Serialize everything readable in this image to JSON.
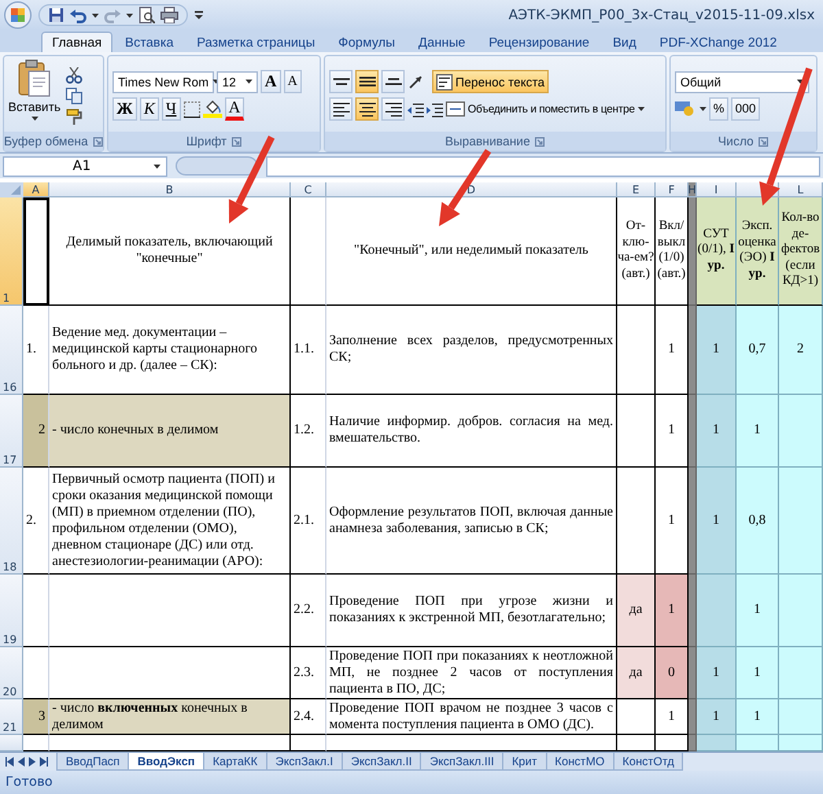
{
  "window": {
    "title": "АЭТК-ЭКМП_Р00_3х-Стац_v2015-11-09.xlsx"
  },
  "ribbon_tabs": [
    {
      "label": "Главная",
      "selected": true
    },
    {
      "label": "Вставка",
      "selected": false
    },
    {
      "label": "Разметка страницы",
      "selected": false
    },
    {
      "label": "Формулы",
      "selected": false
    },
    {
      "label": "Данные",
      "selected": false
    },
    {
      "label": "Рецензирование",
      "selected": false
    },
    {
      "label": "Вид",
      "selected": false
    },
    {
      "label": "PDF-XChange 2012",
      "selected": false
    }
  ],
  "clipboard": {
    "paste_label": "Вставить",
    "group": "Буфер обмена"
  },
  "font": {
    "name": "Times New Rom",
    "size": "12",
    "grow": "A",
    "shrink": "A",
    "bold": "Ж",
    "italic": "К",
    "underline": "Ч",
    "font_color": "A",
    "group": "Шрифт"
  },
  "alignment": {
    "vertical": [
      {
        "kind": "top",
        "selected": false
      },
      {
        "kind": "middle",
        "selected": true
      },
      {
        "kind": "bottom",
        "selected": false
      }
    ],
    "horizontal": [
      {
        "kind": "left",
        "selected": false
      },
      {
        "kind": "center",
        "selected": true
      },
      {
        "kind": "right",
        "selected": false
      }
    ],
    "wrap_text": {
      "label": "Перенос текста",
      "selected": true
    },
    "merge": {
      "label": "Объединить и поместить в центре"
    },
    "group": "Выравнивание"
  },
  "number": {
    "format": "Общий",
    "percent": "%",
    "thousands": "000",
    "group": "Число"
  },
  "formula_bar": {
    "name_box": "A1"
  },
  "sheet": {
    "columns": [
      {
        "letter": "A",
        "selected": true
      },
      {
        "letter": "B",
        "selected": false
      },
      {
        "letter": "C",
        "selected": false
      },
      {
        "letter": "D",
        "selected": false
      },
      {
        "letter": "E",
        "selected": false
      },
      {
        "letter": "F",
        "selected": false
      },
      {
        "letter": "H",
        "selected": false
      },
      {
        "letter": "I",
        "selected": false
      },
      {
        "selected": false
      },
      {
        "letter": "L",
        "selected": false
      }
    ],
    "rows": [
      {
        "number": "1",
        "kind": "header",
        "selected": true,
        "excluded": false,
        "cells": {
          "b": "Делимый показатель, включающий \"конечные\"",
          "d": "\"Конечный\", или неделимый показатель",
          "e": "От-клю-ча-ем? (авт.)",
          "f": "Вкл/выкл (1/0) (авт.)",
          "i": "СУТ (0/1), **I ур.**",
          "k": "Эксп. оценка (ЭО) **I ур.**",
          "l": "Кол-во де-фектов (если КД>1)"
        }
      },
      {
        "number": "16",
        "kind": "item",
        "selected": false,
        "excluded": false,
        "cells": {
          "a": "1.",
          "b": "Ведение мед. документации – медицинской карты стационарного больного и др. (далее – СК):",
          "c": "1.1.",
          "d": "Заполнение всех разделов, предусмотренных СК;",
          "f": "1",
          "i": "1",
          "k": "0,7",
          "l": "2"
        }
      },
      {
        "number": "17",
        "kind": "count",
        "selected": false,
        "excluded": false,
        "cells": {
          "a": "2",
          "b": "- число конечных в делимом",
          "c": "1.2.",
          "d": "Наличие информир. добров. согласия на мед. вмешательство.",
          "f": "1",
          "i": "1",
          "k": "1"
        }
      },
      {
        "number": "18",
        "kind": "item",
        "selected": false,
        "excluded": false,
        "cells": {
          "a": "2.",
          "b": "Первичный осмотр пациента (ПОП) и сроки оказания медицинской помощи (МП) в приемном отделении (ПО), профильном отделении (ОМО), дневном стационаре (ДС) или отд. анестезиологии-реанимации (АРО):",
          "c": "2.1.",
          "d": "Оформление результатов ПОП, включая данные анамнеза заболевания, записью в СК;",
          "f": "1",
          "i": "1",
          "k": "0,8"
        }
      },
      {
        "number": "19",
        "kind": "item",
        "selected": false,
        "excluded": true,
        "cells": {
          "c": "2.2.",
          "d": "Проведение ПОП при угрозе жизни и показаниях к экстренной МП, безотлагательно;",
          "e": "да",
          "f": "1",
          "k": "1"
        }
      },
      {
        "number": "20",
        "kind": "item",
        "selected": false,
        "excluded": true,
        "cells": {
          "c": "2.3.",
          "d": "Проведение ПОП при показаниях к неотложной МП, не позднее 2 часов от поступления пациента в ПО, ДС;",
          "e": "да",
          "f": "0",
          "i": "1",
          "k": "1"
        }
      },
      {
        "number": "21",
        "kind": "count",
        "selected": false,
        "excluded": false,
        "cells": {
          "a": "3",
          "b": "- число **включенных** конечных в делимом",
          "c": "2.4.",
          "d": "Проведение ПОП врачом не позднее 3 часов с момента поступления пациента в ОМО (ДС).",
          "f": "1",
          "i": "1",
          "k": "1"
        }
      }
    ]
  },
  "sheet_tabs": [
    {
      "label": "ВводПасп",
      "selected": false
    },
    {
      "label": "ВводЭксп",
      "selected": true
    },
    {
      "label": "КартаКК",
      "selected": false
    },
    {
      "label": "ЭкспЗакл.I",
      "selected": false
    },
    {
      "label": "ЭкспЗакл.II",
      "selected": false
    },
    {
      "label": "ЭкспЗакл.III",
      "selected": false
    },
    {
      "label": "Крит",
      "selected": false
    },
    {
      "label": "КонстМО",
      "selected": false
    },
    {
      "label": "КонстОтд",
      "selected": false
    }
  ],
  "status_bar": {
    "text": "Готово"
  }
}
